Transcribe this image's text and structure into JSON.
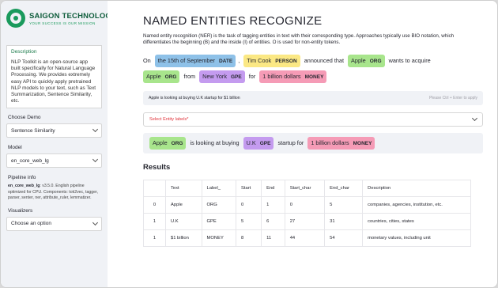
{
  "sidebar": {
    "logo": {
      "name": "SAIGON TECHNOLOGY",
      "tagline": "YOUR SUCCESS IS OUR MISSION"
    },
    "description": {
      "title": "Description",
      "body": "NLP Toolkit is an open-source app built specifically for Natural Language Processing. We provides extremely easy API to quickly apply pretrained NLP models to your text, such as Text Summarization, Sentence Similarity, etc."
    },
    "choose_demo": {
      "label": "Choose Demo",
      "value": "Sentence Similarity"
    },
    "model": {
      "label": "Model",
      "value": "en_core_web_lg"
    },
    "pipeline": {
      "label": "Pipeline info",
      "name": "en_core_web_lg",
      "text": ": v3.5.0. English pipeline optimized for CPU. Components: tok2vec, tagger, parser, senter, ner, attribute_ruler, lemmatizer."
    },
    "visualizers": {
      "label": "Visualizers",
      "value": "Choose an option"
    }
  },
  "main": {
    "title": "NAMED ENTITIES RECOGNIZE",
    "intro": "Named entity recognition (NER) is the task of tagging entities in text with their corresponding type. Approaches typically use BIO notation, which differentiates the beginning (B) and the inside (I) of entities. O is used for non-entity tokens.",
    "example": {
      "w_on": "On",
      "e1_text": "the 15th of September",
      "e1_label": "DATE",
      "w_comma": ",",
      "e2_text": "Tim Cook",
      "e2_label": "PERSON",
      "w_announced": "announced that",
      "e3_text": "Apple",
      "e3_label": "ORG",
      "w_wants": "wants to acquire",
      "e4_text": "Apple",
      "e4_label": "ORG",
      "w_from": "from",
      "e5_text": "New York",
      "e5_label": "GPE",
      "w_for": "for",
      "e6_text": "1 billion dollars",
      "e6_label": "MONEY"
    },
    "input": {
      "value": "Apple is looking at buying U.K startup for $1 billion",
      "hint": "Please Ctrl + Enter to apply"
    },
    "entity_select": {
      "placeholder": "Select Entity labels*"
    },
    "result": {
      "e1_text": "Apple",
      "e1_label": "ORG",
      "w1": "is looking at buying",
      "e2_text": "U.K",
      "e2_label": "GPE",
      "w2": "startup for",
      "e3_text": "1 billion dollars",
      "e3_label": "MONEY"
    },
    "results_heading": "Results",
    "table": {
      "headers": [
        "",
        "Text",
        "Label_",
        "Start",
        "End",
        "Start_char",
        "End_char",
        "Description"
      ],
      "rows": [
        [
          "0",
          "Apple",
          "ORG",
          "0",
          "1",
          "0",
          "5",
          "companies, agencies, institution, etc."
        ],
        [
          "1",
          "U.K",
          "GPE",
          "5",
          "6",
          "27",
          "31",
          "countries, cities, states"
        ],
        [
          "1",
          "$1 billion",
          "MONEY",
          "8",
          "11",
          "44",
          "54",
          "monetary values, including unit"
        ]
      ]
    }
  },
  "colors": {
    "DATE": "#8ec1e8",
    "PERSON": "#fbe884",
    "ORG": "#a8e58c",
    "GPE": "#c49bef",
    "MONEY": "#f59bb6",
    "brand": "#1a9a5c",
    "required": "#e0343c"
  }
}
